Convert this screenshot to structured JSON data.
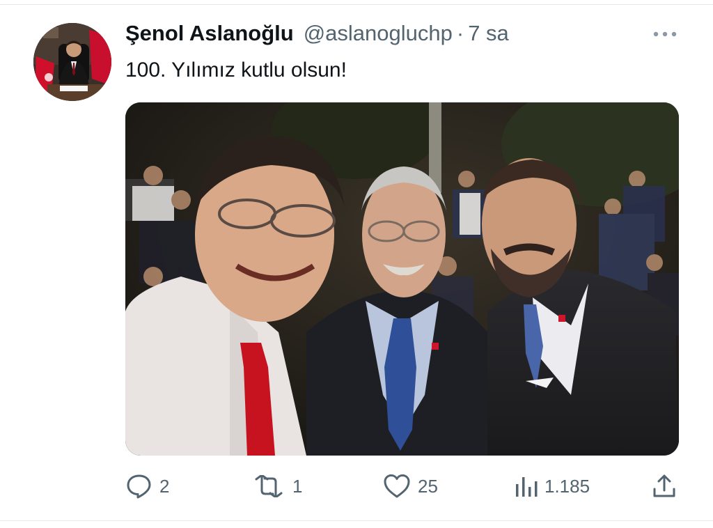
{
  "tweet": {
    "author_name": "Şenol Aslanoğlu",
    "handle": "@aslanogluchp",
    "separator": "·",
    "time": "7 sa",
    "text": "100. Yılımız kutlu olsun!",
    "media_description": "selfie photo",
    "more_icon": "more-horizontal-icon"
  },
  "actions": {
    "replies": "2",
    "retweets": "1",
    "likes": "25",
    "views": "1.185",
    "icons": [
      "reply-icon",
      "retweet-icon",
      "like-icon",
      "views-icon",
      "share-icon"
    ]
  },
  "colors": {
    "text_primary": "#0f1419",
    "text_secondary": "#536471",
    "divider": "#e6e9ea"
  }
}
